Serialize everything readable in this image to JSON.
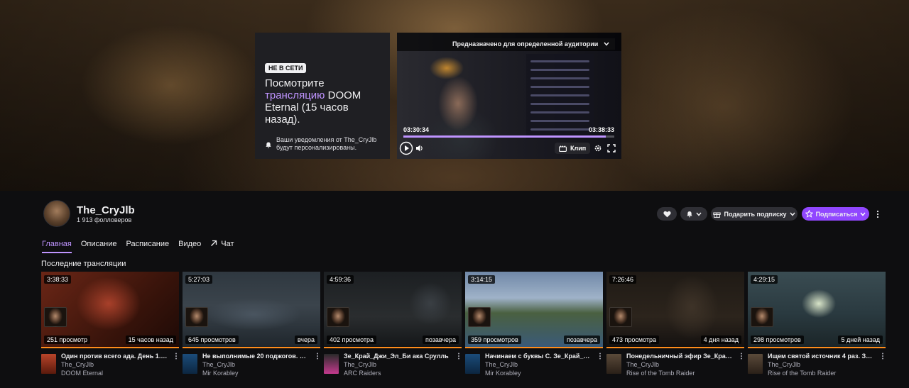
{
  "hero": {
    "offline_badge": "НЕ В СЕТИ",
    "offline_text_1": "Посмотрите",
    "offline_text_accent": "трансляцию",
    "offline_text_2": " DOOM Eternal (15 часов назад).",
    "notify_text": "Ваши уведомления от The_CryJlb будут персонализированы.",
    "player": {
      "audience_label": "Предназначено для определенной аудитории",
      "current_time": "03:30:34",
      "duration": "03:38:33",
      "progress": 0.96,
      "clip_label": "Клип",
      "accent_color": "#bf94ff"
    }
  },
  "channel": {
    "name": "The_CryJlb",
    "followers": "1 913 фолловеров",
    "gift_label": "Подарить подписку",
    "subscribe_label": "Подписаться",
    "brand_color": "#9147ff"
  },
  "tabs": [
    {
      "label": "Главная",
      "active": true
    },
    {
      "label": "Описание",
      "active": false
    },
    {
      "label": "Расписание",
      "active": false
    },
    {
      "label": "Видео",
      "active": false
    },
    {
      "label": "Чат",
      "active": false
    }
  ],
  "section_title": "Последние трансляции",
  "videos": [
    {
      "duration": "3:38:33",
      "views": "251 просмотр",
      "ago": "15 часов назад",
      "title": "Один против всего ада. День 1. Зе...",
      "channel": "The_CryJlb",
      "game": "DOOM Eternal"
    },
    {
      "duration": "5:27:03",
      "views": "645 просмотров",
      "ago": "вчера",
      "title": "Не выполнимые 20 поджогов. Зе_...",
      "channel": "The_CryJlb",
      "game": "Mir Korabley"
    },
    {
      "duration": "4:59:36",
      "views": "402 просмотра",
      "ago": "позавчера",
      "title": "Зе_Край_Джи_Эл_Би ака Срулль",
      "channel": "The_CryJlb",
      "game": "ARC Raiders"
    },
    {
      "duration": "3:14:15",
      "views": "359 просмотров",
      "ago": "позавчера",
      "title": "Начинаем с буквы С. Зе_Край_Дж...",
      "channel": "The_CryJlb",
      "game": "Mir Korabley"
    },
    {
      "duration": "7:26:46",
      "views": "473 просмотра",
      "ago": "4 дня назад",
      "title": "Понедельничный эфир Зе_Край_Д...",
      "channel": "The_CryJlb",
      "game": "Rise of the Tomb Raider"
    },
    {
      "duration": "4:29:15",
      "views": "298 просмотров",
      "ago": "5 дней назад",
      "title": "Ищем святой источник 4 раз. Зе...",
      "channel": "The_CryJlb",
      "game": "Rise of the Tomb Raider"
    }
  ]
}
